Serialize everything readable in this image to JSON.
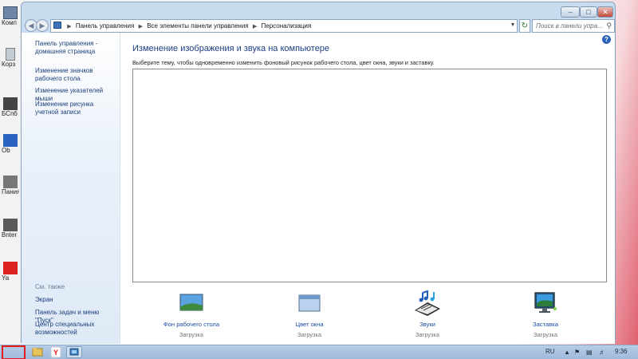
{
  "address_bar": {
    "crumbs": [
      "Панель управления",
      "Все элементы панели управления",
      "Персонализация"
    ]
  },
  "search": {
    "placeholder": "Поиск в панели упра..."
  },
  "sidebar": {
    "home": "Панель управления - домашняя страница",
    "links": [
      "Изменение значков рабочего стола",
      "Изменение указателей мыши",
      "Изменение рисунка учетной записи"
    ],
    "see_also_header": "См. также",
    "see_also": [
      "Экран",
      "Панель задач и меню \"Пуск\"",
      "Центр специальных возможностей"
    ]
  },
  "main": {
    "title": "Изменение изображения и звука на компьютере",
    "description": "Выберите тему, чтобы одновременно изменить фоновый рисунок рабочего стола, цвет окна, звуки и заставку.",
    "tiles": [
      {
        "label": "Фон рабочего стола",
        "status": "Загрузка",
        "icon": "desktop-background-icon"
      },
      {
        "label": "Цвет окна",
        "status": "Загрузка",
        "icon": "window-color-icon"
      },
      {
        "label": "Звуки",
        "status": "Загрузка",
        "icon": "sounds-icon"
      },
      {
        "label": "Заставка",
        "status": "Загрузка",
        "icon": "screensaver-icon"
      }
    ]
  },
  "desktop_icons": [
    {
      "label": "Комп",
      "icon": "computer-icon"
    },
    {
      "label": "Корз",
      "icon": "recycle-bin-icon"
    },
    {
      "label": "БСпб",
      "icon": "app-icon"
    },
    {
      "label": "Ob",
      "icon": "app-icon"
    },
    {
      "label": "Пания",
      "icon": "app-icon"
    },
    {
      "label": "Bnter",
      "icon": "app-icon"
    },
    {
      "label": "Ya",
      "icon": "app-icon"
    }
  ],
  "taskbar": {
    "apps": [
      "explorer-icon",
      "yandex-browser-icon",
      "control-panel-icon"
    ],
    "language": "RU",
    "time": "9:36"
  },
  "colors": {
    "link": "#1b4fa8",
    "title": "#1b3d82",
    "taskbar": "#a9c3e2",
    "start_highlight": "#e21b1b"
  }
}
